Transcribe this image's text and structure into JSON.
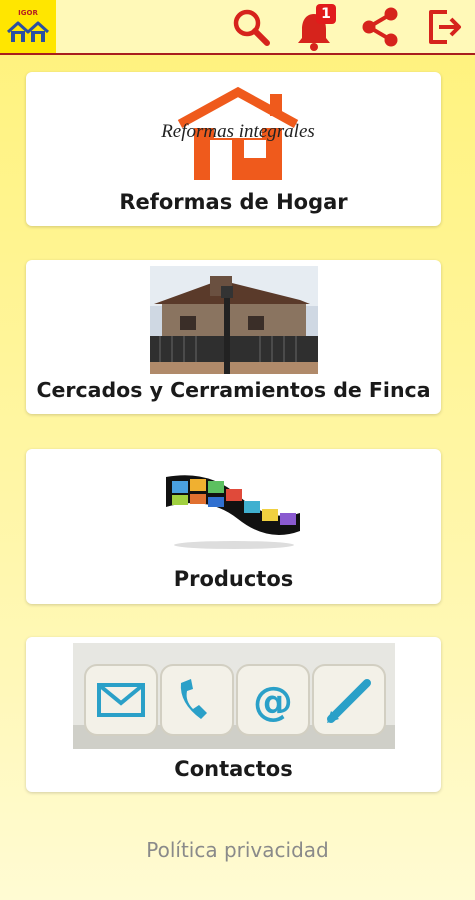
{
  "header": {
    "logo_text": "IGOR",
    "notification_count": "1",
    "icons": [
      "search-icon",
      "bell-icon",
      "share-icon",
      "logout-icon"
    ],
    "accent_color": "#d6231c",
    "background_color": "#fff59a"
  },
  "menu": {
    "items": [
      {
        "label": "Reformas de Hogar",
        "image_text": "Reformas integrales",
        "image": "house-logo"
      },
      {
        "label": "Cercados y Cerramientos de Finca",
        "image": "house-fence-photo"
      },
      {
        "label": "Productos",
        "image": "filmstrip-photo"
      },
      {
        "label": "Contactos",
        "image": "contact-dice-photo"
      }
    ]
  },
  "footer": {
    "privacy_label": "Política privacidad"
  }
}
